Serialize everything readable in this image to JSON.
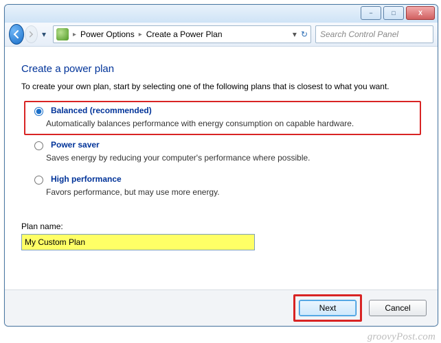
{
  "window": {
    "min_tip": "−",
    "max_tip": "□",
    "close_tip": "X"
  },
  "breadcrumb": {
    "item1": "Power Options",
    "item2": "Create a Power Plan"
  },
  "search": {
    "placeholder": "Search Control Panel"
  },
  "page": {
    "heading": "Create a power plan",
    "intro": "To create your own plan, start by selecting one of the following plans that is closest to what you want."
  },
  "options": [
    {
      "title": "Balanced (recommended)",
      "desc": "Automatically balances performance with energy consumption on capable hardware.",
      "checked": true
    },
    {
      "title": "Power saver",
      "desc": "Saves energy by reducing your computer's performance where possible.",
      "checked": false
    },
    {
      "title": "High performance",
      "desc": "Favors performance, but may use more energy.",
      "checked": false
    }
  ],
  "plan": {
    "label": "Plan name:",
    "value": "My Custom Plan"
  },
  "buttons": {
    "next": "Next",
    "cancel": "Cancel"
  },
  "watermark": "groovyPost.com"
}
